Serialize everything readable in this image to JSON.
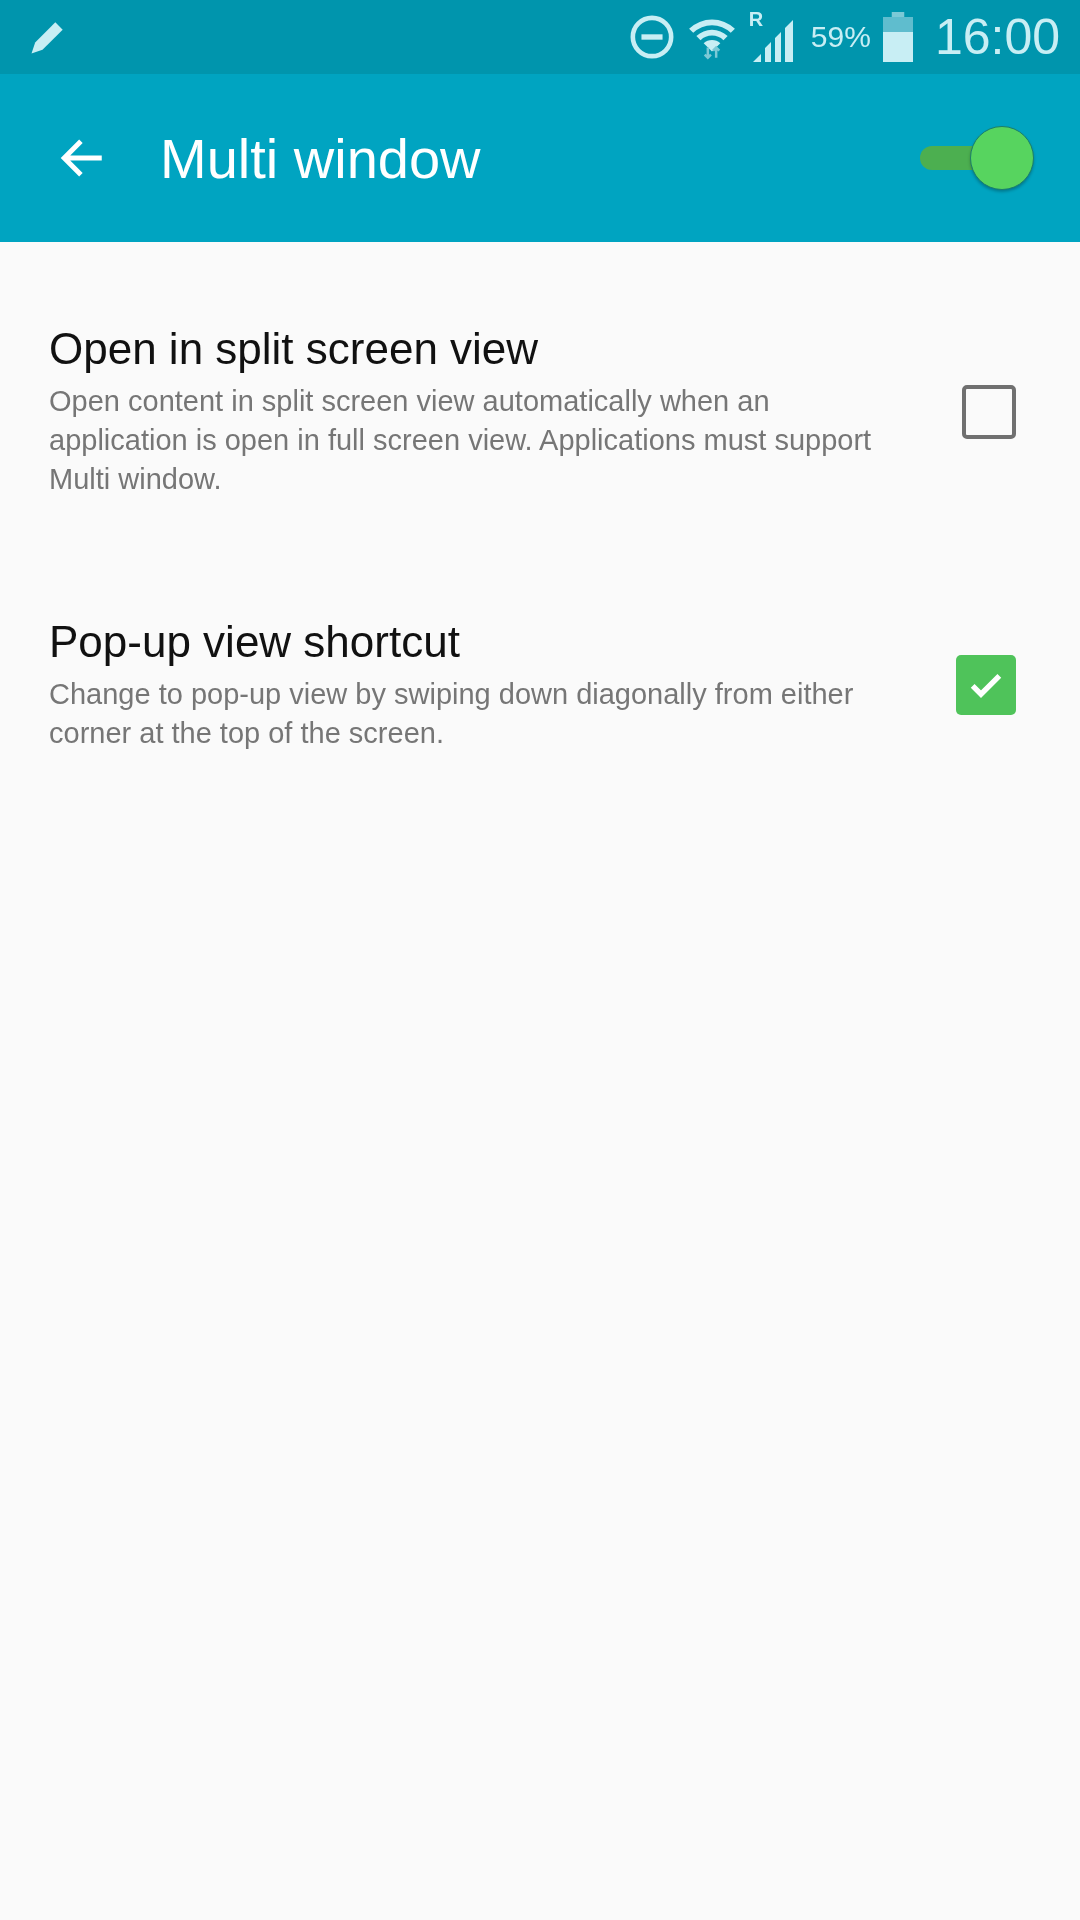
{
  "status_bar": {
    "roaming_label": "R",
    "battery_percent": "59%",
    "time": "16:00"
  },
  "app_bar": {
    "title": "Multi window",
    "master_switch": {
      "on": true
    }
  },
  "settings": [
    {
      "title": "Open in split screen view",
      "description": "Open content in split screen view automatically when an application is open in full screen view. Applications must support Multi window.",
      "checked": false
    },
    {
      "title": "Pop-up view shortcut",
      "description": "Change to pop-up view by swiping down diagonally from either corner at the top of the screen.",
      "checked": true
    }
  ]
}
